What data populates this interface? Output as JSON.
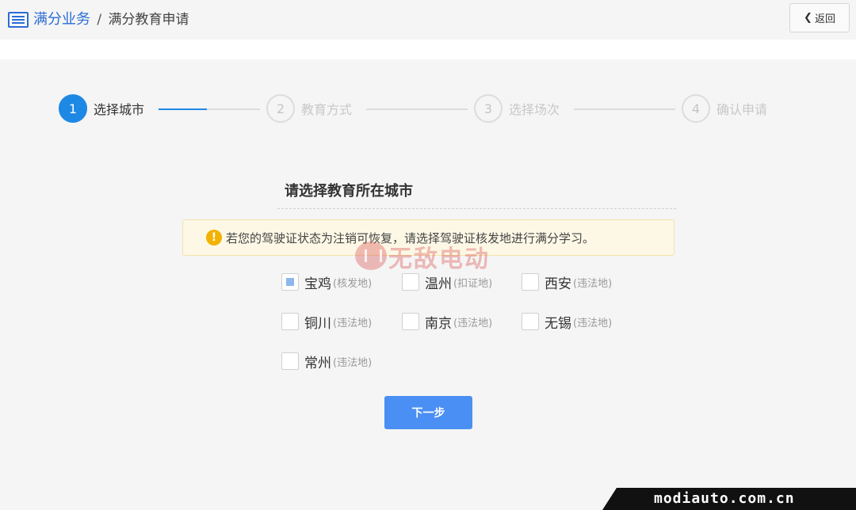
{
  "header": {
    "breadcrumb_root": "满分业务",
    "breadcrumb_separator": "/",
    "breadcrumb_current": "满分教育申请",
    "back_label": "返回",
    "icons": [
      "list-icon",
      "chevron-left-icon"
    ]
  },
  "steps": [
    {
      "number": "1",
      "label": "选择城市",
      "active": true
    },
    {
      "number": "2",
      "label": "教育方式",
      "active": false
    },
    {
      "number": "3",
      "label": "选择场次",
      "active": false
    },
    {
      "number": "4",
      "label": "确认申请",
      "active": false
    }
  ],
  "main": {
    "title": "请选择教育所在城市",
    "notice": "若您的驾驶证状态为注销可恢复，请选择驾驶证核发地进行满分学习。",
    "notice_icon": "warning-icon",
    "cities": [
      {
        "name": "宝鸡",
        "tag": "(核发地)",
        "checked": true
      },
      {
        "name": "温州",
        "tag": "(扣证地)",
        "checked": false
      },
      {
        "name": "西安",
        "tag": "(违法地)",
        "checked": false
      },
      {
        "name": "铜川",
        "tag": "(违法地)",
        "checked": false
      },
      {
        "name": "南京",
        "tag": "(违法地)",
        "checked": false
      },
      {
        "name": "无锡",
        "tag": "(违法地)",
        "checked": false
      },
      {
        "name": "常州",
        "tag": "(违法地)",
        "checked": false
      }
    ],
    "next_label": "下一步"
  },
  "watermark": {
    "text": "无敌电动",
    "corner_text": "modiauto.com.cn"
  },
  "colors": {
    "primary": "#1e88e5",
    "button": "#4a8ff3",
    "link": "#2b6cd4",
    "notice_bg": "#fdf8e6",
    "warning": "#f2b200"
  }
}
